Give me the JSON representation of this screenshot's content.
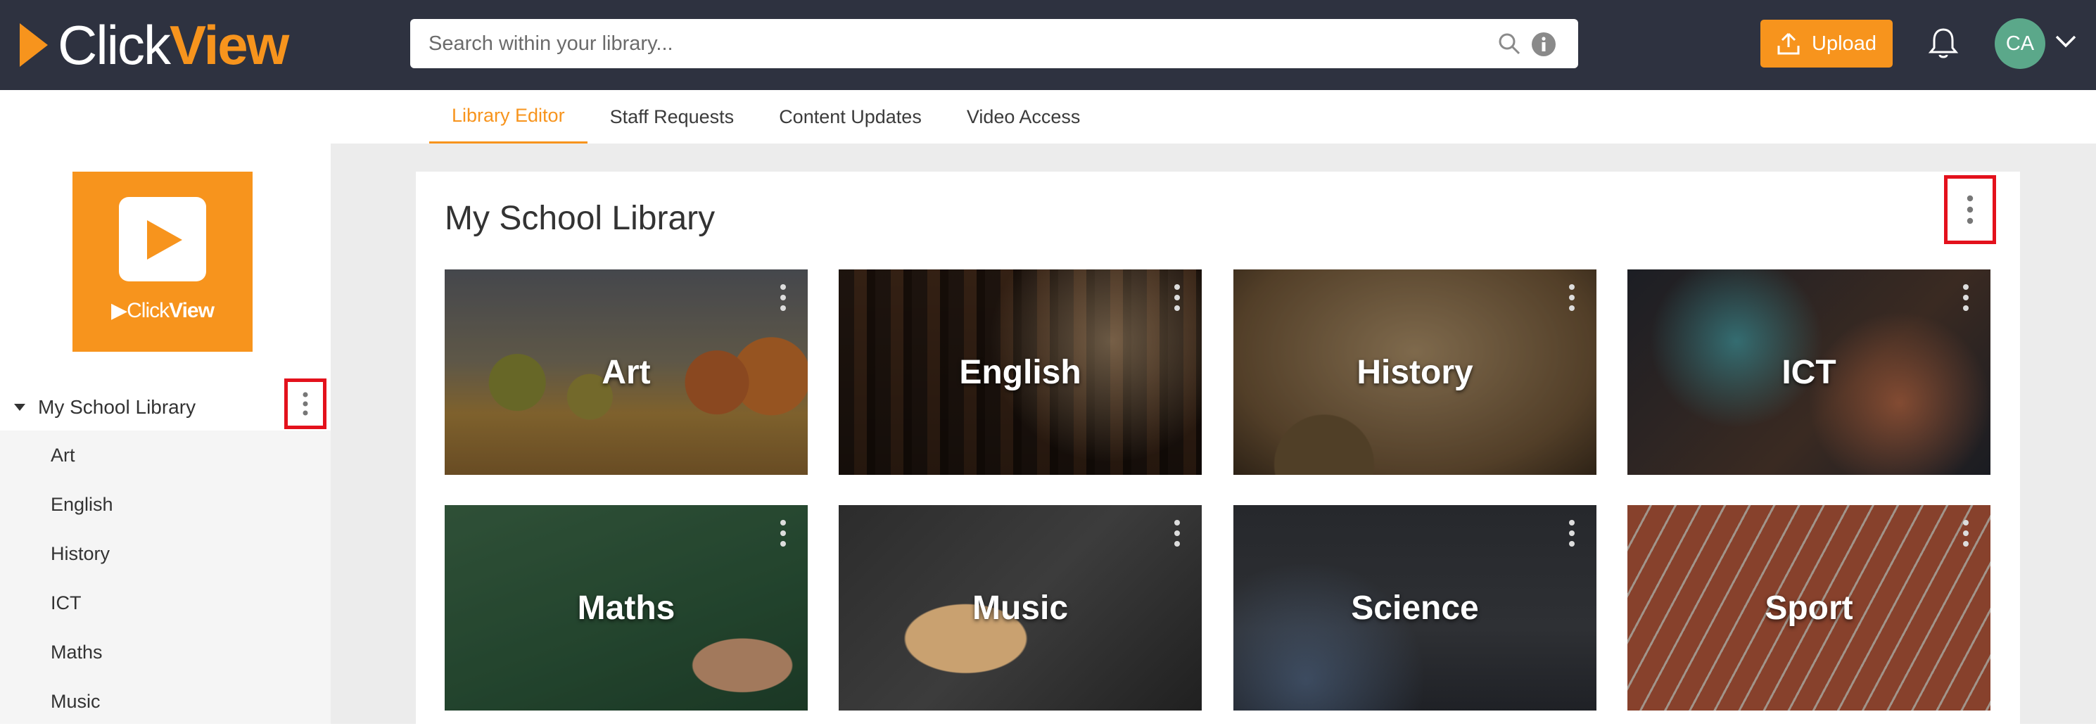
{
  "header": {
    "logo": {
      "click": "Click",
      "view": "View"
    },
    "search": {
      "placeholder": "Search within your library..."
    },
    "upload_label": "Upload",
    "avatar_initials": "CA"
  },
  "tabs": [
    {
      "label": "Library Editor",
      "active": true
    },
    {
      "label": "Staff Requests",
      "active": false
    },
    {
      "label": "Content Updates",
      "active": false
    },
    {
      "label": "Video Access",
      "active": false
    }
  ],
  "sidebar": {
    "logo": {
      "click": "Click",
      "view": "View"
    },
    "root_label": "My School Library",
    "items": [
      "Art",
      "English",
      "History",
      "ICT",
      "Maths",
      "Music"
    ]
  },
  "main": {
    "title": "My School Library",
    "tiles": [
      "Art",
      "English",
      "History",
      "ICT",
      "Maths",
      "Music",
      "Science",
      "Sport"
    ]
  },
  "colors": {
    "brand_orange": "#f7941d",
    "header_bg": "#2e3240",
    "highlight_red": "#e3111c"
  }
}
